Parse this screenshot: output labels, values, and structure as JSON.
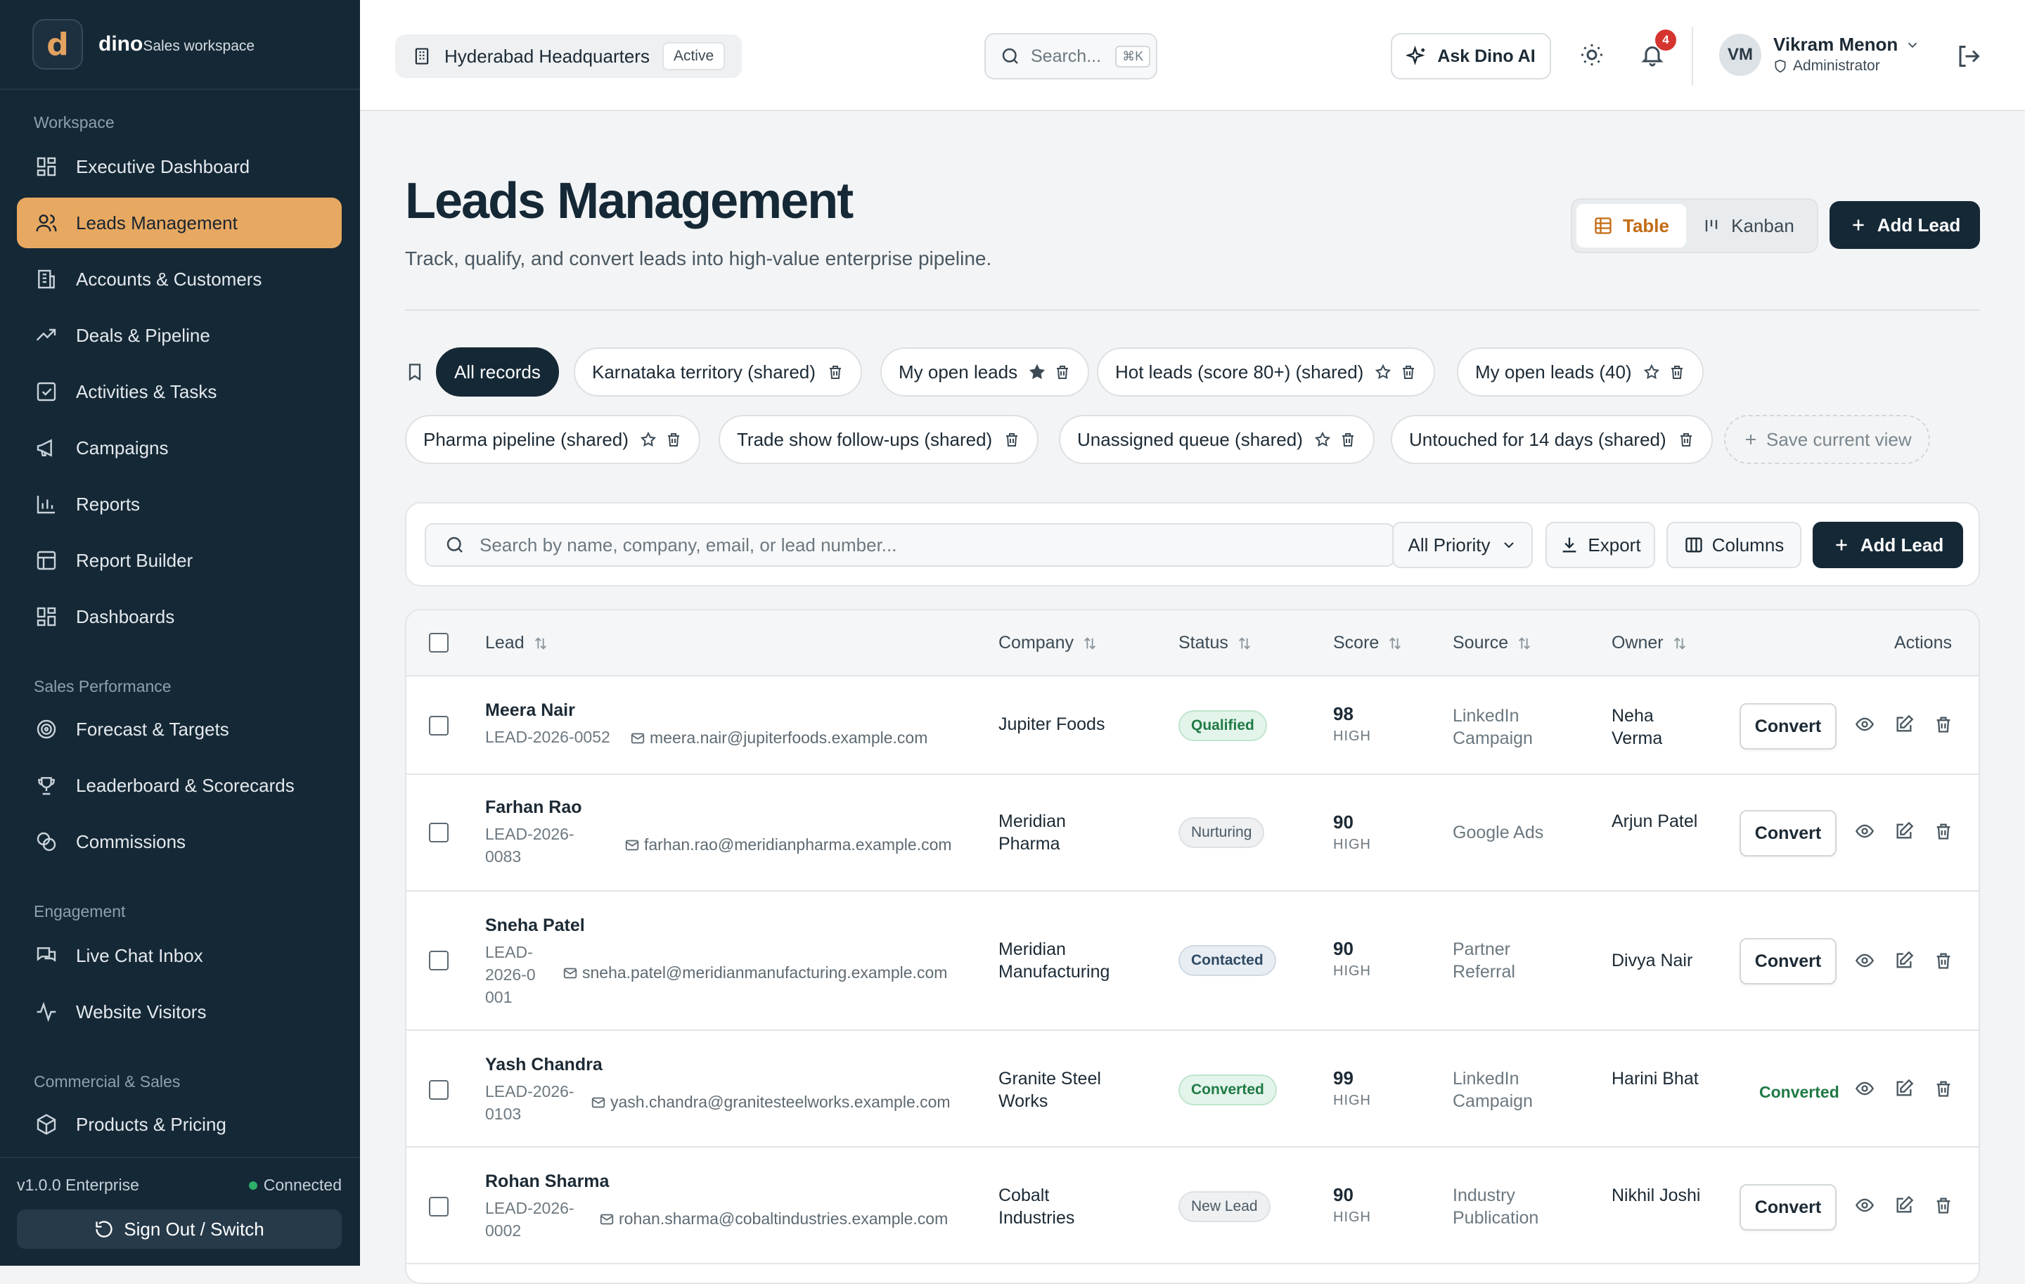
{
  "brand": {
    "name": "dino",
    "subtitle": "Sales workspace",
    "logo_letter": "d"
  },
  "sidebar": {
    "sections": [
      {
        "label": "Workspace",
        "items": [
          {
            "label": "Executive Dashboard",
            "icon": "dashboard-icon"
          },
          {
            "label": "Leads Management",
            "icon": "users-icon",
            "active": true
          },
          {
            "label": "Accounts & Customers",
            "icon": "building-icon"
          },
          {
            "label": "Deals & Pipeline",
            "icon": "trending-up-icon"
          },
          {
            "label": "Activities & Tasks",
            "icon": "checkbox-icon"
          },
          {
            "label": "Campaigns",
            "icon": "megaphone-icon"
          },
          {
            "label": "Reports",
            "icon": "bar-chart-icon"
          },
          {
            "label": "Report Builder",
            "icon": "table-icon"
          },
          {
            "label": "Dashboards",
            "icon": "dashboard-icon"
          }
        ]
      },
      {
        "label": "Sales Performance",
        "items": [
          {
            "label": "Forecast & Targets",
            "icon": "target-icon"
          },
          {
            "label": "Leaderboard & Scorecards",
            "icon": "trophy-icon"
          },
          {
            "label": "Commissions",
            "icon": "coins-icon"
          }
        ]
      },
      {
        "label": "Engagement",
        "items": [
          {
            "label": "Live Chat Inbox",
            "icon": "chat-icon"
          },
          {
            "label": "Website Visitors",
            "icon": "activity-icon"
          }
        ]
      },
      {
        "label": "Commercial & Sales",
        "items": [
          {
            "label": "Products & Pricing",
            "icon": "package-icon"
          }
        ]
      }
    ],
    "version": "v1.0.0 Enterprise",
    "connection": "Connected",
    "sign_out": "Sign Out / Switch"
  },
  "topbar": {
    "location": "Hyderabad Headquarters",
    "location_badge": "Active",
    "search_placeholder": "Search...",
    "search_shortcut": "⌘K",
    "ask_ai": "Ask Dino AI",
    "notifications_count": "4",
    "user": {
      "initials": "VM",
      "name": "Vikram Menon",
      "role": "Administrator"
    }
  },
  "page": {
    "title": "Leads Management",
    "subtitle": "Track, qualify, and convert leads into high-value enterprise pipeline.",
    "view_table": "Table",
    "view_kanban": "Kanban",
    "add_lead": "Add Lead"
  },
  "saved_views": [
    {
      "label": "All records",
      "active": true
    },
    {
      "label": "Karnataka territory (shared)",
      "star": false,
      "starred": false
    },
    {
      "label": "My open leads",
      "star": true,
      "starred": true
    },
    {
      "label": "Hot leads (score 80+) (shared)",
      "star": true,
      "starred": false
    },
    {
      "label": "My open leads (40)",
      "star": true,
      "starred": false
    },
    {
      "label": "Pharma pipeline (shared)",
      "star": true,
      "starred": false
    },
    {
      "label": "Trade show follow-ups (shared)",
      "star": false,
      "starred": false
    },
    {
      "label": "Unassigned queue (shared)",
      "star": true,
      "starred": false
    },
    {
      "label": "Untouched for 14 days (shared)",
      "star": false,
      "starred": false
    }
  ],
  "save_view": "Save current view",
  "toolbar": {
    "search_placeholder": "Search by name, company, email, or lead number...",
    "priority": "All Priority",
    "export": "Export",
    "columns": "Columns",
    "add_lead": "Add Lead"
  },
  "table": {
    "headers": {
      "lead": "Lead",
      "company": "Company",
      "status": "Status",
      "score": "Score",
      "source": "Source",
      "owner": "Owner",
      "actions": "Actions"
    },
    "convert_label": "Convert",
    "rows": [
      {
        "name": "Meera Nair",
        "id": "LEAD-2026-0052",
        "email": "meera.nair@jupiterfoods.example.com",
        "company": "Jupiter Foods",
        "status": "Qualified",
        "score": "98",
        "score_label": "HIGH",
        "source": "LinkedIn Campaign",
        "owner": "Neha Verma",
        "converted": false
      },
      {
        "name": "Farhan Rao",
        "id": "LEAD-2026-0083",
        "email": "farhan.rao@meridianpharma.example.com",
        "company": "Meridian Pharma",
        "status": "Nurturing",
        "score": "90",
        "score_label": "HIGH",
        "source": "Google Ads",
        "owner": "Arjun Patel",
        "converted": false
      },
      {
        "name": "Sneha Patel",
        "id": "LEAD-2026-0001",
        "email": "sneha.patel@meridianmanufacturing.example.com",
        "company": "Meridian Manufacturing",
        "status": "Contacted",
        "score": "90",
        "score_label": "HIGH",
        "source": "Partner Referral",
        "owner": "Divya Nair",
        "converted": false
      },
      {
        "name": "Yash Chandra",
        "id": "LEAD-2026-0103",
        "email": "yash.chandra@granitesteelworks.example.com",
        "company": "Granite Steel Works",
        "status": "Converted",
        "score": "99",
        "score_label": "HIGH",
        "source": "LinkedIn Campaign",
        "owner": "Harini Bhat",
        "converted": true,
        "converted_label": "Converted"
      },
      {
        "name": "Rohan Sharma",
        "id": "LEAD-2026-0002",
        "email": "rohan.sharma@cobaltindustries.example.com",
        "company": "Cobalt Industries",
        "status": "New Lead",
        "score": "90",
        "score_label": "HIGH",
        "source": "Industry Publication",
        "owner": "Nikhil Joshi",
        "converted": false
      }
    ]
  }
}
